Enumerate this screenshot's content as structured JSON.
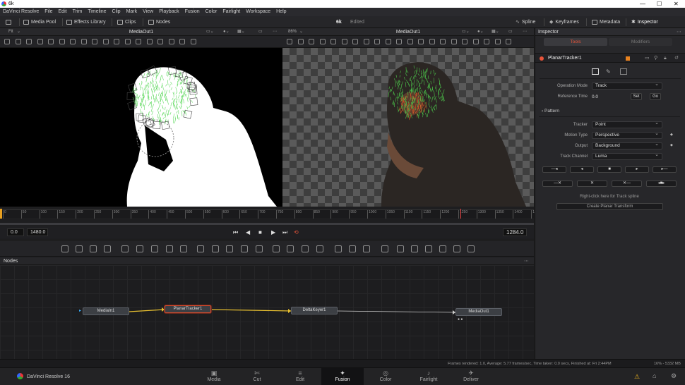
{
  "window": {
    "title": "6k"
  },
  "menu": [
    "DaVinci Resolve",
    "File",
    "Edit",
    "Trim",
    "Timeline",
    "Clip",
    "Mark",
    "View",
    "Playback",
    "Fusion",
    "Color",
    "Fairlight",
    "Workspace",
    "Help"
  ],
  "toolbar": {
    "media_pool": "Media Pool",
    "effects_library": "Effects Library",
    "clips": "Clips",
    "nodes": "Nodes",
    "project_name": "6k",
    "project_status": "Edited",
    "spline": "Spline",
    "keyframes": "Keyframes",
    "metadata": "Metadata",
    "inspector": "Inspector"
  },
  "viewer_left": {
    "fit": "Fit",
    "title": "MediaOut1"
  },
  "viewer_right": {
    "zoom": "86%",
    "title": "MediaOut1"
  },
  "ruler": {
    "ticks": [
      "0",
      "50",
      "100",
      "150",
      "200",
      "250",
      "300",
      "350",
      "400",
      "450",
      "500",
      "550",
      "600",
      "650",
      "700",
      "750",
      "800",
      "850",
      "900",
      "950",
      "1000",
      "1050",
      "1100",
      "1150",
      "1200",
      "1250",
      "1300",
      "1350",
      "1400",
      "1450"
    ]
  },
  "transport": {
    "start": "0.0",
    "end": "1480.0",
    "current": "1284.0"
  },
  "nodes_panel": {
    "title": "Nodes",
    "nodes": [
      {
        "label": "MediaIn1"
      },
      {
        "label": "PlanarTracker1"
      },
      {
        "label": "DeltaKeyer1"
      },
      {
        "label": "MediaOut1"
      }
    ]
  },
  "inspector": {
    "title": "Inspector",
    "tabs": {
      "tools": "Tools",
      "modifiers": "Modifiers"
    },
    "node_name": "PlanarTracker1",
    "operation_mode_label": "Operation Mode",
    "operation_mode": "Track",
    "reference_time_label": "Reference Time",
    "reference_time": "0.0",
    "set_label": "Set",
    "go_label": "Go",
    "pattern_label": "Pattern",
    "tracker_label": "Tracker",
    "tracker": "Point",
    "motion_type_label": "Motion Type",
    "motion_type": "Perspective",
    "output_label": "Output",
    "output": "Background",
    "track_channel_label": "Track Channel",
    "track_channel": "Luma",
    "hint": "Right-click here for Track spline",
    "create_transform": "Create Planar Transform"
  },
  "status": {
    "frames": "Frames rendered: 1.0,  Average: 5.77 frames/sec,  Time taken: 0.0 secs,  Finished at: Fri 2:44PM",
    "memory": "16% - 5332 MB"
  },
  "pagebar": {
    "app": "DaVinci Resolve 16",
    "pages": [
      "Media",
      "Cut",
      "Edit",
      "Fusion",
      "Color",
      "Fairlight",
      "Deliver"
    ],
    "active": "Fusion"
  },
  "colors": {
    "accent": "#e8543a",
    "active_tab": "#d84a2b",
    "tracker_green": "#4fd64f"
  }
}
